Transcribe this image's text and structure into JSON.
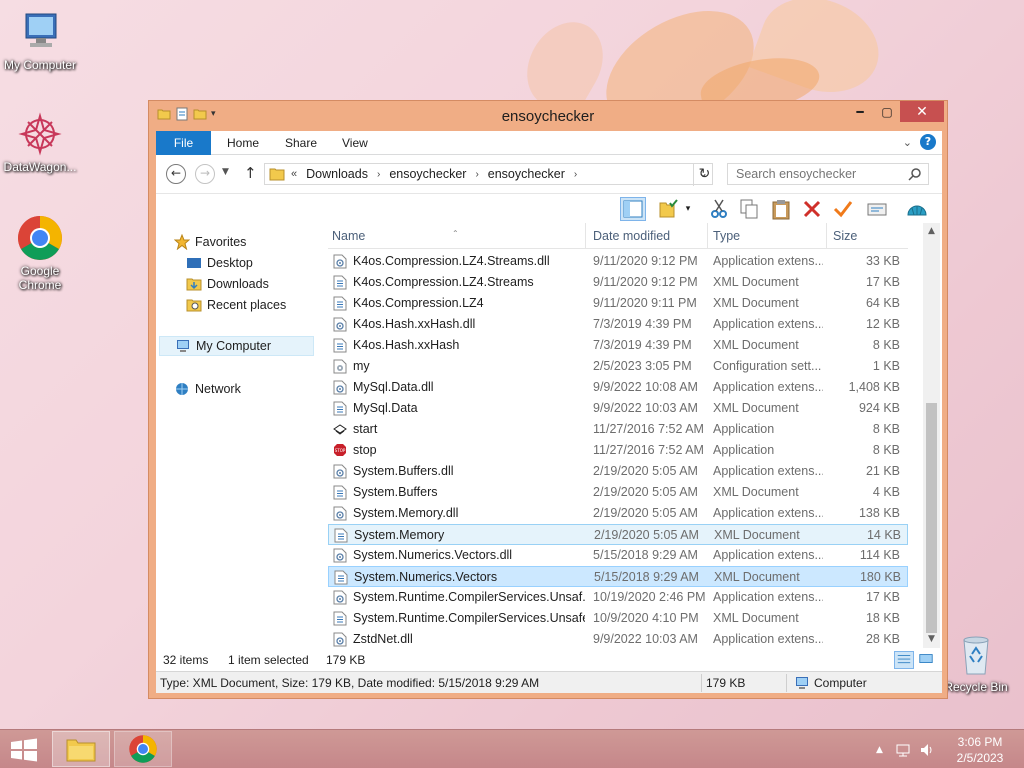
{
  "desktop": {
    "icons": [
      {
        "label": "My Computer"
      },
      {
        "label": "DataWagon..."
      },
      {
        "label": "Google Chrome"
      },
      {
        "label": "Recycle Bin"
      }
    ]
  },
  "window": {
    "title": "ensoychecker",
    "ribbon_tabs": [
      "File",
      "Home",
      "Share",
      "View"
    ],
    "address": {
      "lead": "«",
      "crumbs": [
        "Downloads",
        "ensoychecker",
        "ensoychecker"
      ],
      "search_placeholder": "Search ensoychecker"
    },
    "nav": {
      "favorites": "Favorites",
      "desktop": "Desktop",
      "downloads": "Downloads",
      "recent": "Recent places",
      "computer": "My Computer",
      "network": "Network"
    },
    "columns": {
      "name": "Name",
      "date": "Date modified",
      "type": "Type",
      "size": "Size"
    },
    "files": [
      {
        "name": "K4os.Compression.LZ4.Streams.dll",
        "date": "9/11/2020 9:12 PM",
        "type": "Application extens...",
        "size": "33 KB",
        "icon": "dll"
      },
      {
        "name": "K4os.Compression.LZ4.Streams",
        "date": "9/11/2020 9:12 PM",
        "type": "XML Document",
        "size": "17 KB",
        "icon": "xml"
      },
      {
        "name": "K4os.Compression.LZ4",
        "date": "9/11/2020 9:11 PM",
        "type": "XML Document",
        "size": "64 KB",
        "icon": "xml"
      },
      {
        "name": "K4os.Hash.xxHash.dll",
        "date": "7/3/2019 4:39 PM",
        "type": "Application extens...",
        "size": "12 KB",
        "icon": "dll"
      },
      {
        "name": "K4os.Hash.xxHash",
        "date": "7/3/2019 4:39 PM",
        "type": "XML Document",
        "size": "8 KB",
        "icon": "xml"
      },
      {
        "name": "my",
        "date": "2/5/2023 3:05 PM",
        "type": "Configuration sett...",
        "size": "1 KB",
        "icon": "cfg"
      },
      {
        "name": "MySql.Data.dll",
        "date": "9/9/2022 10:08 AM",
        "type": "Application extens...",
        "size": "1,408 KB",
        "icon": "dll"
      },
      {
        "name": "MySql.Data",
        "date": "9/9/2022 10:03 AM",
        "type": "XML Document",
        "size": "924 KB",
        "icon": "xml"
      },
      {
        "name": "start",
        "date": "11/27/2016 7:52 AM",
        "type": "Application",
        "size": "8 KB",
        "icon": "start"
      },
      {
        "name": "stop",
        "date": "11/27/2016 7:52 AM",
        "type": "Application",
        "size": "8 KB",
        "icon": "stop"
      },
      {
        "name": "System.Buffers.dll",
        "date": "2/19/2020 5:05 AM",
        "type": "Application extens...",
        "size": "21 KB",
        "icon": "dll"
      },
      {
        "name": "System.Buffers",
        "date": "2/19/2020 5:05 AM",
        "type": "XML Document",
        "size": "4 KB",
        "icon": "xml"
      },
      {
        "name": "System.Memory.dll",
        "date": "2/19/2020 5:05 AM",
        "type": "Application extens...",
        "size": "138 KB",
        "icon": "dll"
      },
      {
        "name": "System.Memory",
        "date": "2/19/2020 5:05 AM",
        "type": "XML Document",
        "size": "14 KB",
        "icon": "xml",
        "state": "hover"
      },
      {
        "name": "System.Numerics.Vectors.dll",
        "date": "5/15/2018 9:29 AM",
        "type": "Application extens...",
        "size": "114 KB",
        "icon": "dll"
      },
      {
        "name": "System.Numerics.Vectors",
        "date": "5/15/2018 9:29 AM",
        "type": "XML Document",
        "size": "180 KB",
        "icon": "xml",
        "state": "selected"
      },
      {
        "name": "System.Runtime.CompilerServices.Unsaf...",
        "date": "10/19/2020 2:46 PM",
        "type": "Application extens...",
        "size": "17 KB",
        "icon": "dll"
      },
      {
        "name": "System.Runtime.CompilerServices.Unsafe",
        "date": "10/9/2020 4:10 PM",
        "type": "XML Document",
        "size": "18 KB",
        "icon": "xml"
      },
      {
        "name": "ZstdNet.dll",
        "date": "9/9/2022 10:03 AM",
        "type": "Application extens...",
        "size": "28 KB",
        "icon": "dll"
      }
    ],
    "status": {
      "item_count": "32 items",
      "selected": "1 item selected",
      "selected_size": "179 KB"
    },
    "details_bar": {
      "info": "Type: XML Document, Size: 179 KB, Date modified: 5/15/2018 9:29 AM",
      "size": "179 KB",
      "location": "Computer"
    }
  },
  "taskbar": {
    "time": "3:06 PM",
    "date": "2/5/2023"
  },
  "colors": {
    "window_frame": "#f0ad85",
    "close_button": "#c75050",
    "file_tab": "#1979ca",
    "selection": "#cce8ff",
    "taskbar": "#c98f8c"
  }
}
